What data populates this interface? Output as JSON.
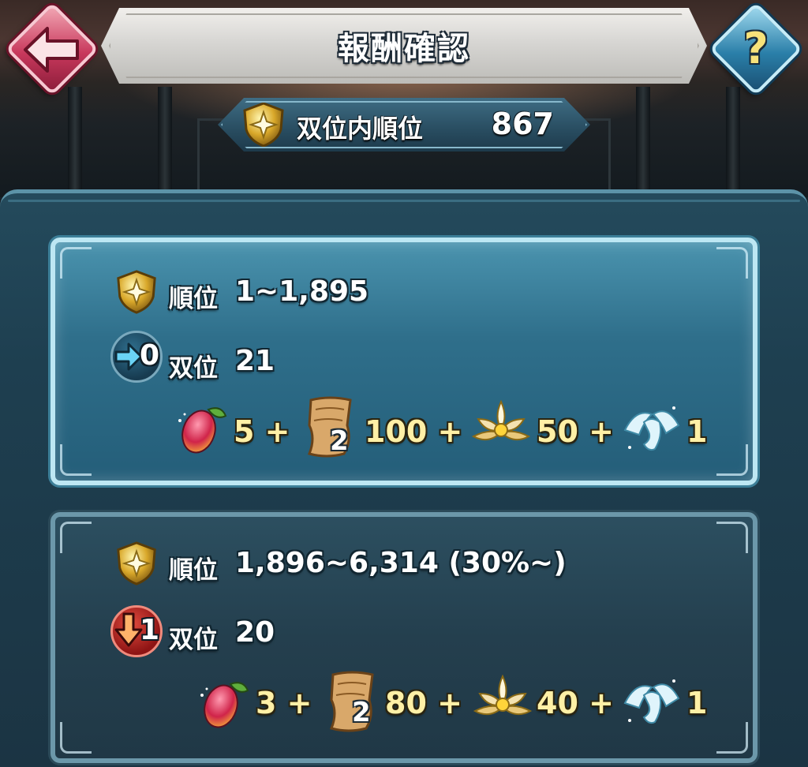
{
  "header": {
    "title": "報酬確認",
    "help_glyph": "?"
  },
  "rank_summary": {
    "label": "双位内順位",
    "value": "867"
  },
  "rewards": [
    {
      "rank_label": "順位",
      "rank_range": "1~1,895",
      "tier_change": "0",
      "tier_change_icon": "arrow-right-icon",
      "tier_label": "双位",
      "tier_value": "21",
      "items": [
        {
          "icon": "fruit-icon",
          "amount": "5 +"
        },
        {
          "icon": "scroll-icon",
          "badge": "2",
          "amount": "100 +"
        },
        {
          "icon": "lotus-icon",
          "amount": "50 +"
        },
        {
          "icon": "dragon-icon",
          "amount": "1"
        }
      ]
    },
    {
      "rank_label": "順位",
      "rank_range": "1,896~6,314 (30%~)",
      "tier_change": "1",
      "tier_change_icon": "arrow-down-icon",
      "tier_label": "双位",
      "tier_value": "20",
      "items": [
        {
          "icon": "fruit-icon",
          "amount": "3 +"
        },
        {
          "icon": "scroll-icon",
          "badge": "2",
          "amount": "80 +"
        },
        {
          "icon": "lotus-icon",
          "amount": "40 +"
        },
        {
          "icon": "dragon-icon",
          "amount": "1"
        }
      ]
    }
  ],
  "colors": {
    "panel": "#244a5c",
    "highlight_card": "#4a93ae",
    "amount_text": "#fff0a6",
    "back_button": "#c8385c",
    "help_button": "#2a7fa9"
  }
}
